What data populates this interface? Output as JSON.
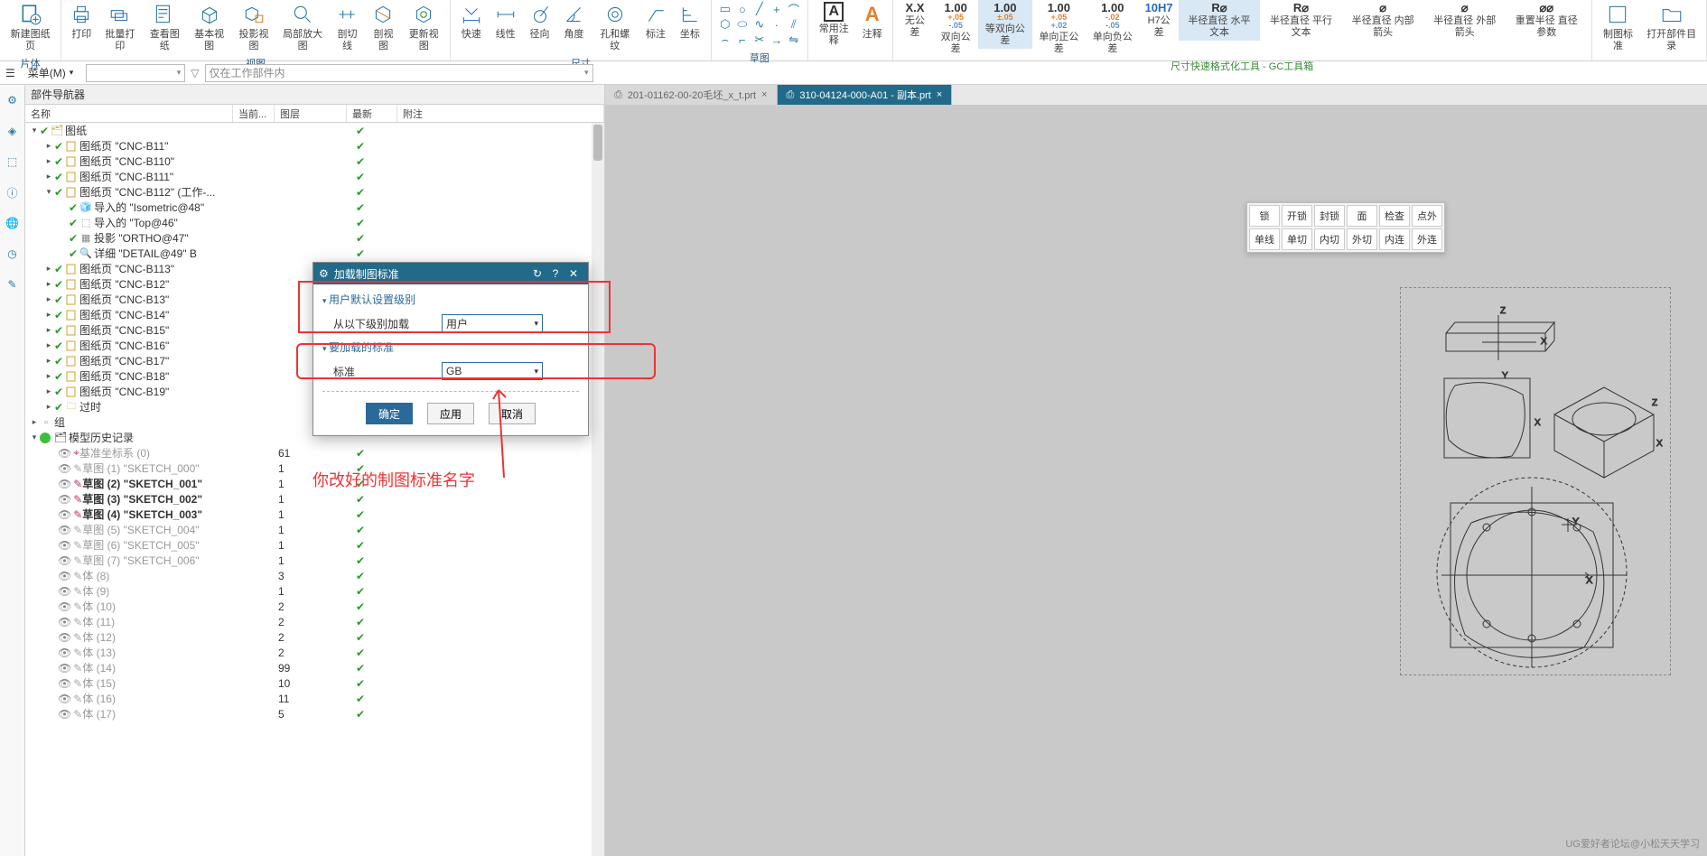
{
  "ribbon": {
    "groups": {
      "sheet": {
        "label": "片体",
        "items": [
          {
            "l": "新建图纸页"
          },
          {
            "l": "打印"
          },
          {
            "l": "批量打印"
          }
        ]
      },
      "view": {
        "label": "视图",
        "items": [
          {
            "l": "查看图纸"
          },
          {
            "l": "基本视图"
          },
          {
            "l": "投影视图"
          },
          {
            "l": "局部放大图"
          },
          {
            "l": "剖切线"
          },
          {
            "l": "剖视图"
          },
          {
            "l": "更新视图"
          }
        ]
      },
      "dim": {
        "label": "尺寸",
        "items": [
          {
            "l": "快速"
          },
          {
            "l": "线性"
          },
          {
            "l": "径向"
          },
          {
            "l": "角度"
          },
          {
            "l": "孔和螺纹"
          },
          {
            "l": "标注"
          },
          {
            "l": "坐标"
          }
        ]
      },
      "sketch": {
        "label": "草图"
      },
      "annot": {
        "items": [
          {
            "l": "常用注释"
          },
          {
            "l": "注释"
          }
        ]
      },
      "gc": {
        "label": "尺寸快速格式化工具 - GC工具箱",
        "items": [
          {
            "t": "X.X",
            "l": "无公差"
          },
          {
            "t": "1.00",
            "s1": "+.05",
            "s2": "-.05",
            "l": "双向公差"
          },
          {
            "t": "1.00",
            "s1": "±.05",
            "l": "等双向公差",
            "hl": true
          },
          {
            "t": "1.00",
            "s1": "+.05",
            "s2": "+.02",
            "l": "单向正公差"
          },
          {
            "t": "1.00",
            "s1": "-.02",
            "s2": "-.05",
            "l": "单向负公差"
          },
          {
            "t": "10H7",
            "l": "H7公差",
            "c": "#2a6ac0"
          },
          {
            "t": "R⌀",
            "l": "半径直径\n水平文本",
            "hl": true
          },
          {
            "t": "R⌀",
            "l": "半径直径\n平行文本"
          },
          {
            "t": "⌀",
            "l": "半径直径\n内部箭头"
          },
          {
            "t": "⌀",
            "l": "半径直径\n外部箭头"
          },
          {
            "t": "⌀⌀",
            "l": "重置半径\n直径参数"
          }
        ]
      },
      "std": {
        "items": [
          {
            "l": "制图标准"
          },
          {
            "l": "打开部件目录"
          }
        ]
      }
    }
  },
  "menubar": {
    "menu": "菜单(M)",
    "filter": "仅在工作部件内"
  },
  "navigator": {
    "title": "部件导航器",
    "cols": {
      "c1": "名称",
      "c2": "当前...",
      "c3": "图层",
      "c4": "最新",
      "c5": "附注"
    },
    "root": "图纸",
    "sheets": [
      {
        "n": "图纸页 \"CNC-B11\""
      },
      {
        "n": "图纸页 \"CNC-B110\""
      },
      {
        "n": "图纸页 \"CNC-B111\""
      },
      {
        "n": "图纸页 \"CNC-B112\" (工作-...",
        "exp": true,
        "kids": [
          {
            "n": "导入的 \"Isometric@48\"",
            "ic": "iso"
          },
          {
            "n": "导入的 \"Top@46\"",
            "ic": "top"
          },
          {
            "n": "投影 \"ORTHO@47\"",
            "ic": "proj"
          },
          {
            "n": "详细 \"DETAIL@49\" B",
            "ic": "det"
          }
        ]
      },
      {
        "n": "图纸页 \"CNC-B113\""
      },
      {
        "n": "图纸页 \"CNC-B12\""
      },
      {
        "n": "图纸页 \"CNC-B13\""
      },
      {
        "n": "图纸页 \"CNC-B14\""
      },
      {
        "n": "图纸页 \"CNC-B15\""
      },
      {
        "n": "图纸页 \"CNC-B16\""
      },
      {
        "n": "图纸页 \"CNC-B17\""
      },
      {
        "n": "图纸页 \"CNC-B18\""
      },
      {
        "n": "图纸页 \"CNC-B19\""
      }
    ],
    "timer": "过时",
    "group": "组",
    "history": "模型历史记录",
    "hist": [
      {
        "n": "基准坐标系 (0)",
        "v": "61",
        "dim": true,
        "ic": "csys"
      },
      {
        "n": "草图 (1) \"SKETCH_000\"",
        "v": "1",
        "dim": true
      },
      {
        "n": "草图 (2) \"SKETCH_001\"",
        "v": "1",
        "b": true
      },
      {
        "n": "草图 (3) \"SKETCH_002\"",
        "v": "1",
        "b": true
      },
      {
        "n": "草图 (4) \"SKETCH_003\"",
        "v": "1",
        "b": true
      },
      {
        "n": "草图 (5) \"SKETCH_004\"",
        "v": "1",
        "dim": true
      },
      {
        "n": "草图 (6) \"SKETCH_005\"",
        "v": "1",
        "dim": true
      },
      {
        "n": "草图 (7) \"SKETCH_006\"",
        "v": "1",
        "dim": true
      },
      {
        "n": "体 (8)",
        "v": "3",
        "dim": true
      },
      {
        "n": "体 (9)",
        "v": "1",
        "dim": true
      },
      {
        "n": "体 (10)",
        "v": "2",
        "dim": true
      },
      {
        "n": "体 (11)",
        "v": "2",
        "dim": true
      },
      {
        "n": "体 (12)",
        "v": "2",
        "dim": true
      },
      {
        "n": "体 (13)",
        "v": "2",
        "dim": true
      },
      {
        "n": "体 (14)",
        "v": "99",
        "dim": true
      },
      {
        "n": "体 (15)",
        "v": "10",
        "dim": true
      },
      {
        "n": "体 (16)",
        "v": "11",
        "dim": true
      },
      {
        "n": "体 (17)",
        "v": "5",
        "dim": true
      }
    ]
  },
  "dialog": {
    "title": "加载制图标准",
    "sec1": "用户默认设置级别",
    "lbl_level": "从以下级别加载",
    "val_level": "用户",
    "sec2": "要加载的标准",
    "lbl_std": "标准",
    "val_std": "GB",
    "ok": "确定",
    "apply": "应用",
    "cancel": "取消"
  },
  "annotation": "你改好的制图标准名字",
  "tabs": [
    {
      "n": "201-01162-00-20毛坯_x_t.prt",
      "active": false
    },
    {
      "n": "310-04124-000-A01 - 副本.prt",
      "active": true
    }
  ],
  "toolbar2": [
    [
      "锁",
      "开锁",
      "封锁",
      "面",
      "检查",
      "点外"
    ],
    [
      "单线",
      "单切",
      "内切",
      "外切",
      "内连",
      "外连"
    ]
  ],
  "watermark": "UG爱好者论坛@小松天天学习"
}
